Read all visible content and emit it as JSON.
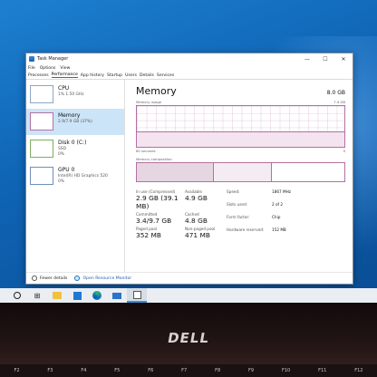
{
  "window": {
    "title": "Task Manager",
    "controls": {
      "minimize": "—",
      "maximize": "☐",
      "close": "✕"
    }
  },
  "menu": [
    "File",
    "Options",
    "View"
  ],
  "tabs": [
    "Processes",
    "Performance",
    "App history",
    "Startup",
    "Users",
    "Details",
    "Services"
  ],
  "sidebar": {
    "items": [
      {
        "name": "CPU",
        "sub1": "1% 1.50 GHz",
        "sub2": ""
      },
      {
        "name": "Memory",
        "sub1": "2.9/7.9 GB (37%)",
        "sub2": ""
      },
      {
        "name": "Disk 0 (C:)",
        "sub1": "SSD",
        "sub2": "0%"
      },
      {
        "name": "GPU 0",
        "sub1": "Intel(R) HD Graphics 520",
        "sub2": "0%"
      }
    ]
  },
  "memory": {
    "title": "Memory",
    "total": "8.0 GB",
    "usage_label": "Memory usage",
    "usage_max": "7.9 GB",
    "axis_left": "60 seconds",
    "axis_right": "0",
    "composition_label": "Memory composition",
    "usage_fraction": 0.37,
    "stats": {
      "in_use_label": "In use (Compressed)",
      "in_use": "2.9 GB (39.1 MB)",
      "available_label": "Available",
      "available": "4.9 GB",
      "committed_label": "Committed",
      "committed": "3.4/9.7 GB",
      "cached_label": "Cached",
      "cached": "4.8 GB",
      "paged_pool_label": "Paged pool",
      "paged_pool": "352 MB",
      "non_paged_pool_label": "Non-paged pool",
      "non_paged_pool": "471 MB"
    },
    "details": [
      {
        "k": "Speed:",
        "v": "1867 MHz"
      },
      {
        "k": "Slots used:",
        "v": "2 of 2"
      },
      {
        "k": "Form factor:",
        "v": "Chip"
      },
      {
        "k": "Hardware reserved:",
        "v": "152 MB"
      }
    ]
  },
  "footer": {
    "fewer_details": "Fewer details",
    "open_monitor": "Open Resource Monitor"
  },
  "taskbar": {
    "start_icon": "circle-search-icon"
  },
  "bezel": {
    "logo": "DELL",
    "fkeys": [
      "F2",
      "F3",
      "F4",
      "F5",
      "F6",
      "F7",
      "F8",
      "F9",
      "F10",
      "F11",
      "F12"
    ]
  }
}
